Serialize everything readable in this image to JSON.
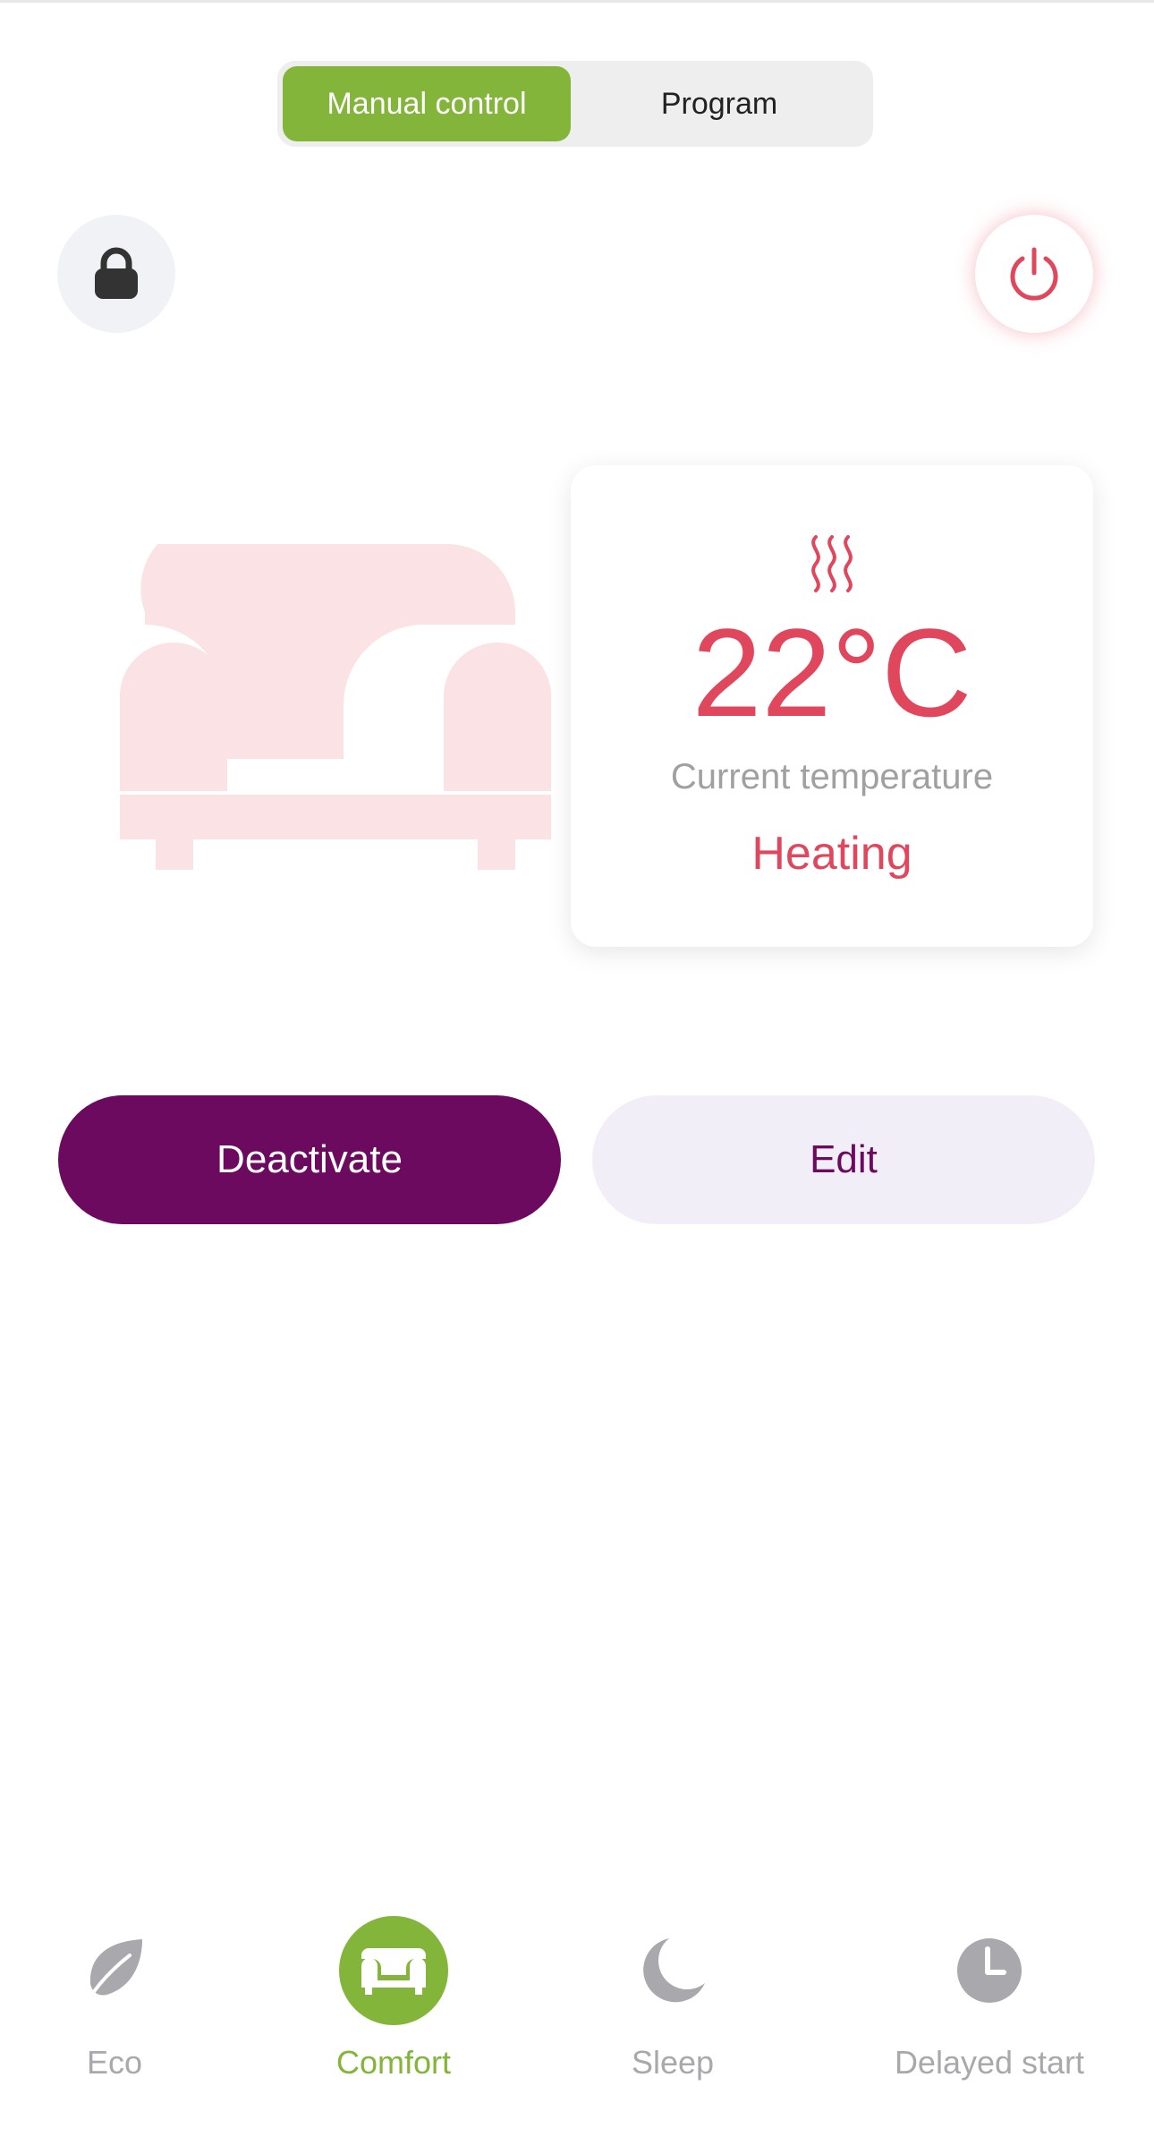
{
  "mode_switch": {
    "options": [
      "Manual control",
      "Program"
    ],
    "selected": "Manual control"
  },
  "status_card": {
    "temperature": "22°C",
    "temperature_label": "Current temperature",
    "state": "Heating"
  },
  "actions": {
    "deactivate_label": "Deactivate",
    "edit_label": "Edit"
  },
  "tabs": [
    {
      "label": "Eco",
      "icon": "leaf-icon"
    },
    {
      "label": "Comfort",
      "icon": "armchair-icon",
      "active": true
    },
    {
      "label": "Sleep",
      "icon": "moon-icon"
    },
    {
      "label": "Delayed start",
      "icon": "clock-icon"
    }
  ],
  "colors": {
    "accent_green": "#83b53a",
    "heating_red": "#e0475c",
    "primary_purple": "#6b0a5e",
    "sofa_pink": "#fbe3e5"
  }
}
